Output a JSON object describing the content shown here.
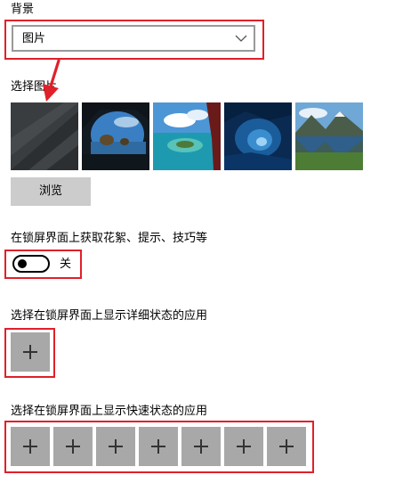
{
  "section_background": {
    "title": "背景",
    "dropdown_value": "图片"
  },
  "choose_picture": {
    "label": "选择图片",
    "thumbnails": [
      {
        "name": "dark-gray-abstract"
      },
      {
        "name": "sea-cave-arch"
      },
      {
        "name": "tropical-island"
      },
      {
        "name": "ice-cave"
      },
      {
        "name": "mountain-lake"
      }
    ],
    "browse_label": "浏览"
  },
  "lock_screen_tips": {
    "label": "在锁屏界面上获取花絮、提示、技巧等",
    "toggle_state": "关"
  },
  "detailed_status": {
    "label": "选择在锁屏界面上显示详细状态的应用"
  },
  "quick_status": {
    "label": "选择在锁屏界面上显示快速状态的应用",
    "slot_count": 7
  },
  "colors": {
    "highlight": "#e0202a",
    "tile": "#a8a8a8",
    "button": "#cccccc"
  }
}
